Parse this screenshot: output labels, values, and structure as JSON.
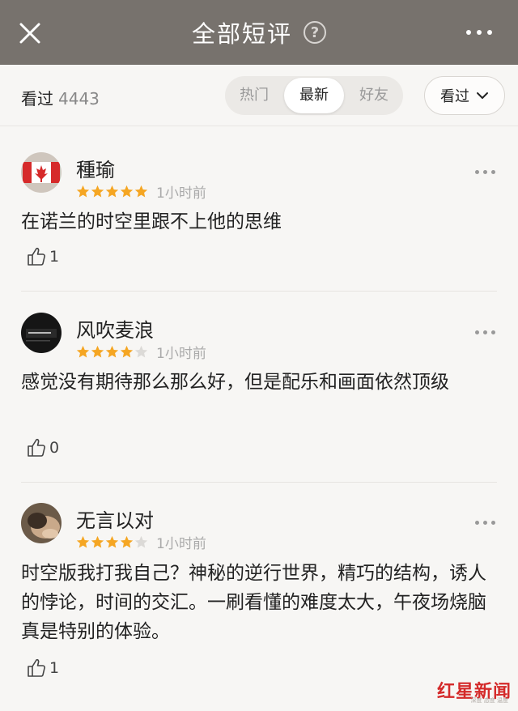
{
  "header": {
    "title": "全部短评",
    "help_glyph": "?"
  },
  "filter": {
    "seen_label": "看过",
    "seen_count": "4443",
    "tabs": [
      "热门",
      "最新",
      "好友"
    ],
    "active_tab": "最新",
    "dropdown_label": "看过"
  },
  "comments": [
    {
      "user": "種瑜",
      "rating": 5,
      "time": "1小时前",
      "text": "在诺兰的时空里跟不上他的思维",
      "likes": "1"
    },
    {
      "user": "风吹麦浪",
      "rating": 4,
      "time": "1小时前",
      "text": "感觉没有期待那么那么好，但是配乐和画面依然顶级",
      "likes": "0"
    },
    {
      "user": "无言以对",
      "rating": 4,
      "time": "1小时前",
      "text": "时空版我打我自己？神秘的逆行世界，精巧的结构，诱人的悖论，时间的交汇。一刷看懂的难度太大，午夜场烧脑真是特别的体验。",
      "likes": "1"
    }
  ],
  "watermark": {
    "brand": "红星新闻",
    "tagline": "深度 态度 温度"
  },
  "colors": {
    "header_bg": "#77726d",
    "star_filled": "#f5a623",
    "star_empty": "#dcdad7",
    "watermark_red": "#d42a2a"
  }
}
